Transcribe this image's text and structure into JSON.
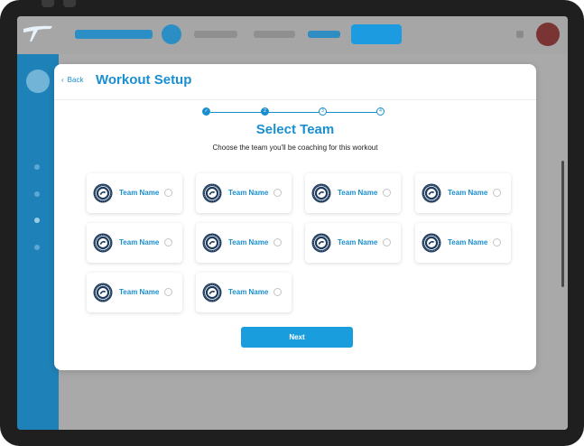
{
  "modal": {
    "back_label": "Back",
    "title": "Workout Setup",
    "heading": "Select Team",
    "subtitle": "Choose the team you'll be coaching for this workout",
    "next_label": "Next"
  },
  "stepper": {
    "steps": [
      "✓",
      "2",
      "3",
      "4"
    ],
    "current_step": 2
  },
  "teams": [
    {
      "name": "Team Name",
      "selected": false
    },
    {
      "name": "Team Name",
      "selected": false
    },
    {
      "name": "Team Name",
      "selected": false
    },
    {
      "name": "Team Name",
      "selected": false
    },
    {
      "name": "Team Name",
      "selected": false
    },
    {
      "name": "Team Name",
      "selected": false
    },
    {
      "name": "Team Name",
      "selected": false
    },
    {
      "name": "Team Name",
      "selected": false
    },
    {
      "name": "Team Name",
      "selected": false
    },
    {
      "name": "Team Name",
      "selected": false
    }
  ],
  "colors": {
    "accent": "#1a8fd0",
    "button": "#1a9ddd",
    "sidebar": "#1e82b8",
    "team_logo": "#1d3a5c"
  },
  "icons": {
    "back": "chevron-left-icon",
    "step_done": "check-icon",
    "team_logo": "team-crest-icon"
  }
}
